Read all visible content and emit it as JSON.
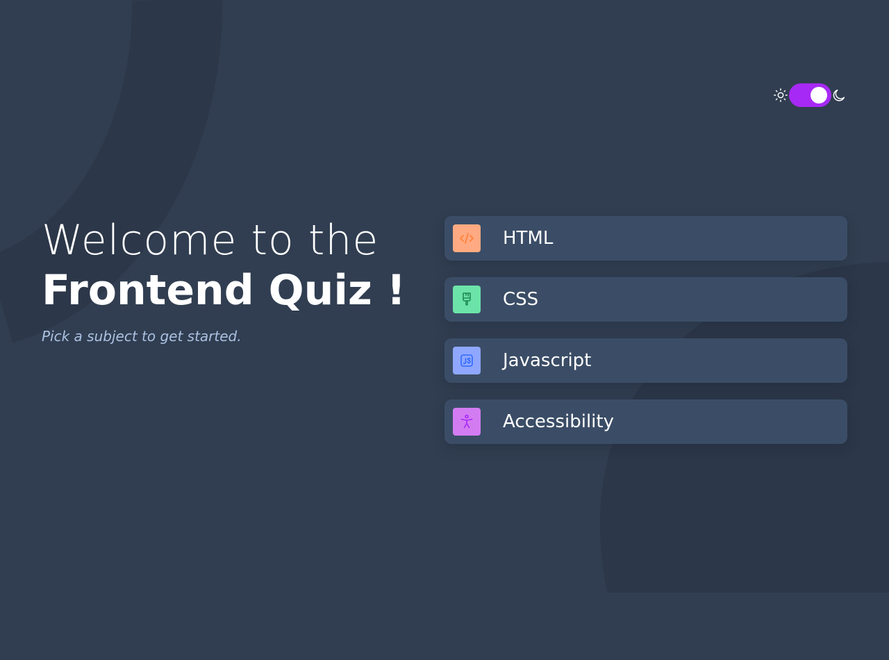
{
  "heading": {
    "line1": "Welcome to the",
    "line2": "Frontend Quiz !",
    "subtitle": "Pick a subject to get started."
  },
  "theme_toggle": {
    "state": "dark",
    "sun_icon": "sun-icon",
    "moon_icon": "moon-icon"
  },
  "subjects": [
    {
      "label": "HTML",
      "icon": "code-icon",
      "icon_bg": "#ffaa82",
      "icon_color": "#ff7e35"
    },
    {
      "label": "CSS",
      "icon": "paintbrush-icon",
      "icon_bg": "#6ce3a8",
      "icon_color": "#26d782"
    },
    {
      "label": "Javascript",
      "icon": "js-icon",
      "icon_bg": "#8fa7ff",
      "icon_color": "#306aff"
    },
    {
      "label": "Accessibility",
      "icon": "accessibility-icon",
      "icon_bg": "#d37cf2",
      "icon_color": "#a729f5"
    }
  ],
  "colors": {
    "background": "#313e51",
    "card": "#3b4d66",
    "accent": "#a729f5",
    "subtitle": "#abc1e1"
  }
}
